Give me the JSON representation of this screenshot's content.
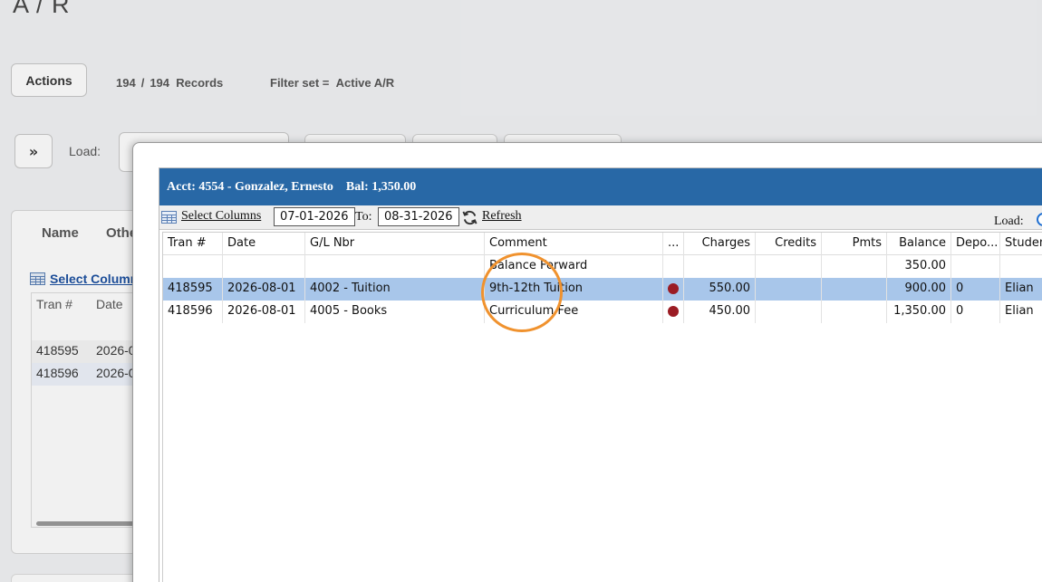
{
  "page": {
    "title": "A / R",
    "actions_label": "Actions",
    "records_shown": "194",
    "records_sep": "/",
    "records_total": "194",
    "records_label": "Records",
    "filter_label": "Filter set =",
    "filter_value": "Active A/R",
    "expand_label": "»",
    "load_label": "Load:"
  },
  "background_list": {
    "col_name": "Name",
    "col_other": "Othe",
    "select_columns": "Select Column",
    "headers": [
      "Tran #",
      "Date"
    ],
    "rows": [
      {
        "tran": "418595",
        "date": "2026-0"
      },
      {
        "tran": "418596",
        "date": "2026-0"
      }
    ]
  },
  "modal": {
    "header": {
      "account": "Acct: 4554 - Gonzalez, Ernesto",
      "balance": "Bal: 1,350.00"
    },
    "toolbar": {
      "select_columns": "Select Columns",
      "date_from": "07-01-2026",
      "to_label": "To:",
      "date_to": "08-31-2026",
      "refresh_label": "Refresh",
      "load_label": "Load:"
    },
    "columns": [
      "Tran #",
      "Date",
      "G/L Nbr",
      "Comment",
      "...",
      "Charges",
      "Credits",
      "Pmts",
      "Balance",
      "Depo...",
      "Studen"
    ],
    "rows": [
      {
        "tran": "",
        "date": "",
        "gl": "",
        "comment": "Balance Forward",
        "flag": false,
        "charges": "",
        "credits": "",
        "pmts": "",
        "balance": "350.00",
        "depo": "",
        "student": "",
        "selected": false
      },
      {
        "tran": "418595",
        "date": "2026-08-01",
        "gl": "4002 - Tuition",
        "comment": "9th-12th Tuition",
        "flag": true,
        "charges": "550.00",
        "credits": "",
        "pmts": "",
        "balance": "900.00",
        "depo": "0",
        "student": "Elian",
        "selected": true
      },
      {
        "tran": "418596",
        "date": "2026-08-01",
        "gl": "4005 - Books",
        "comment": "Curriculum Fee",
        "flag": true,
        "charges": "450.00",
        "credits": "",
        "pmts": "",
        "balance": "1,350.00",
        "depo": "0",
        "student": "Elian",
        "selected": false
      }
    ]
  },
  "colors": {
    "header_blue": "#2868a6",
    "selected_row": "#a8c6ea",
    "flag_dot": "#9b1c24",
    "annotation": "#f0922e"
  }
}
